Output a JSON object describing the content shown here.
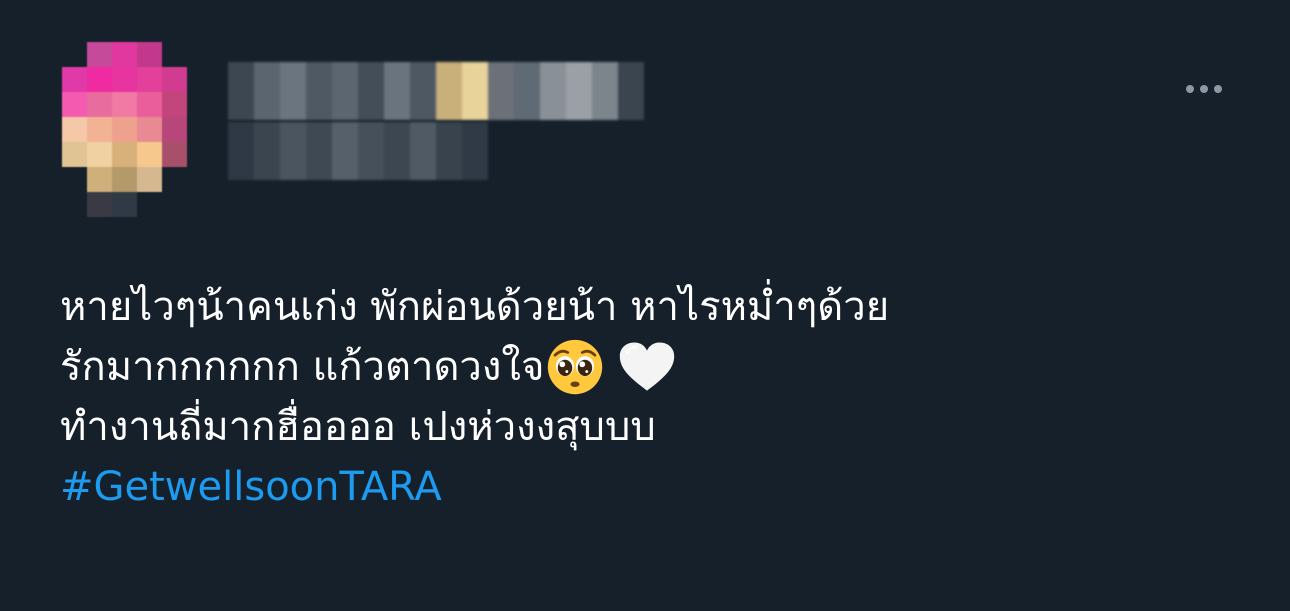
{
  "tweet": {
    "lines": [
      "หายไวๆน้าคนเก่ง พักผ่อนด้วยน้า หาไรหม่ำๆด้วย",
      "รักมากกกกกก แก้วตาดวงใจ",
      "ทำงานถี่มากฮื่ออออ เปงห่วงงสุบบบ"
    ],
    "hashtag": "#GetwellsoonTARA",
    "emojis": [
      "pleading-face-emoji",
      "white-heart-emoji"
    ]
  },
  "colors": {
    "background": "#15202b",
    "text": "#ffffff",
    "hashtag": "#1d9bf0",
    "icon": "#8b98a5"
  },
  "icons": {
    "more": "more-horizontal-icon"
  }
}
